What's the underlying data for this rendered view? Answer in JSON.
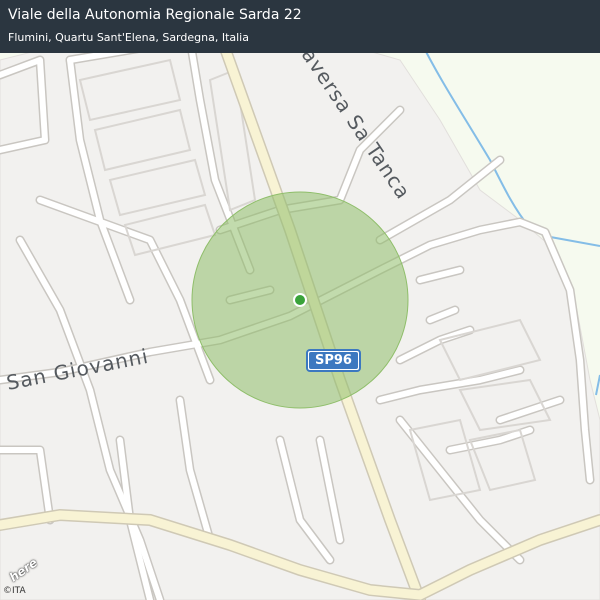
{
  "header": {
    "title": "Viale della Autonomia Regionale Sarda 22",
    "subtitle": "Flumini, Quartu Sant'Elena, Sardegna, Italia"
  },
  "map": {
    "labels": {
      "street_traversa": "Traversa Sa Tanca",
      "street_san_giovanni": "San Giovanni",
      "route_shield": "SP96"
    },
    "logo": "here",
    "copyright": "©ITA",
    "colors": {
      "land": "#f3f1ee",
      "green": "#f7fbef",
      "accuracy_circle": "#8fbe6a",
      "location_dot": "#3aa33a",
      "water": "#7fb8e6",
      "main_road": "#f8f3d6",
      "road_casing": "#cdc9c3"
    }
  }
}
